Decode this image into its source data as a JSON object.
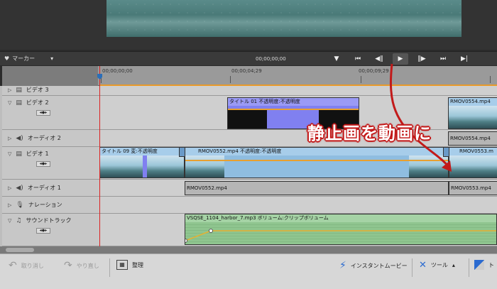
{
  "marker": {
    "label": "マーカー"
  },
  "transport": {
    "timecode": "00;00;00;00"
  },
  "ruler": {
    "tc_start": "00;00;00;00",
    "tc_mid": "00;00;04;29",
    "tc_end": "00;00;09;29"
  },
  "tracks": {
    "video3": "ビデオ 3",
    "video2": "ビデオ 2",
    "audio2": "オーディオ 2",
    "video1": "ビデオ 1",
    "audio1": "オーディオ 1",
    "narration": "ナレーション",
    "soundtrack": "サウンドトラック"
  },
  "clips": {
    "title01": "タイトル 01 不透明度:不透明度",
    "title09": "タイトル 09 変:不透明度",
    "rmov0552_video": "RMOV0552.mp4 不透明度:不透明度",
    "rmov0553_video": "RMOV0553.m",
    "rmov0554_video2": "RMOV0554.mp4",
    "rmov0554_audio2": "RMOV0554.mp4",
    "rmov0552_audio": "RMOV0552.mp4",
    "rmov0553_audio": "RMOV0553.mp4",
    "soundtrack_clip": "VSQSE_1104_harbor_7.mp3 ボリューム:クリップボリューム"
  },
  "annotation": "静止画を動画に",
  "toolbar": {
    "undo": "取り消し",
    "redo": "やり直し",
    "organize": "整理",
    "instant_movie": "インスタントムービー",
    "tools": "ツール",
    "transitions": "ト"
  },
  "colors": {
    "accent_red": "#c21a1a",
    "clip_blue": "#8fbde0",
    "title_purple": "#8080f0",
    "audio_green": "#8fc58f"
  }
}
